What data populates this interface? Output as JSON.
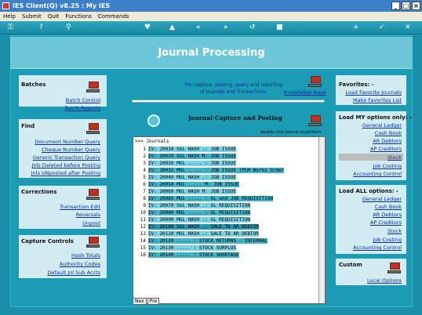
{
  "window": {
    "title": "IES Client(Q) v8.25 : My IES"
  },
  "menu": [
    "Help",
    "Submit",
    "Quit",
    "Functions",
    "Commands"
  ],
  "header": {
    "title": "Journal Processing"
  },
  "info": {
    "line1": "For capture, posting, query and reporting",
    "line2": "of Journals and Transactions.",
    "knowledge": "Knowledge Base"
  },
  "capture": {
    "title": "Journal Capture and Posting",
    "hint": "double-click journal to perform"
  },
  "left": {
    "batches": {
      "label": "Batches",
      "links": [
        "Batch Control",
        "Batch Reports"
      ]
    },
    "find": {
      "label": "Find",
      "links": [
        "Document Number Query",
        "Cheque Number Query",
        "Generic Transaction Query",
        "Jnls Deleted before Posting",
        "Jnls UNposted after Posting"
      ]
    },
    "corrections": {
      "label": "Corrections",
      "links": [
        "Transaction Edit",
        "Reversals",
        "Unpost"
      ]
    },
    "capture_controls": {
      "label": "Capture Controls",
      "links": [
        "Hash Totals",
        "Authority Codes",
        "Default Jnl Sub Accts"
      ]
    }
  },
  "right": {
    "favorites": {
      "label": "Favorites: -",
      "links": [
        "Load Favorite Journals",
        "Make Favorites List"
      ]
    },
    "my": {
      "label": "Load MY options only: -",
      "links": [
        "General Ledger",
        "Cash Book",
        "AR Debtors",
        "AP Creditors",
        "Stock",
        "Job Costing",
        "Accounting Control"
      ]
    },
    "all": {
      "label": "Load ALL options: -",
      "links": [
        "General Ledger",
        "Cash Book",
        "AR Debtors",
        "AP Creditors",
        "Stock",
        "Job Costing",
        "Accounting Control"
      ]
    },
    "custom": {
      "label": "Custom",
      "links": [
        "Local Options"
      ]
    }
  },
  "list": {
    "header": ">>> Journals",
    "rows": [
      {
        "n": "1",
        "t": "IV: 20010 SGL HASH .: JOB ISSUE"
      },
      {
        "n": "2",
        "t": "IV: 20020 SGL HASH M: JOB ISSUE"
      },
      {
        "n": "3",
        "t": "IV: 20030 MUL ..... : JOB ISSUE"
      },
      {
        "n": "4",
        "t": "IV: 20032 MUL ..... : JOB ISSUE (PLM Works Order"
      },
      {
        "n": "5",
        "t": "IV: 20040 MUL HASH .: JOB ISSUE"
      },
      {
        "n": "6",
        "t": "IV: 20050 MUL ..... M: JOB ISSUE"
      },
      {
        "n": "7",
        "t": "IV: 20060 MUL HASH M: JOB ISSUE"
      },
      {
        "n": "8",
        "t": "IV: 20065 MUL ..... : GL and JOB REQUISITION"
      },
      {
        "n": "9",
        "t": "IV: 20070 SGL HASH .: GL REQUISITION"
      },
      {
        "n": "10",
        "t": "IV: 20080 MUL ..... : GL REQUISITION"
      },
      {
        "n": "11",
        "t": "IV: 20090 MUL HASH .: GL REQUISITION"
      },
      {
        "n": "12",
        "t": "IV: 20100 SGL HASH .: SALE TO AR DEBTOR"
      },
      {
        "n": "13",
        "t": "IV: 20110 MUL HASH .: SALE TO AR DEBTOR"
      },
      {
        "n": "14",
        "t": "IV: 20120 ..... : STOCK RETURNS - INTERNAL"
      },
      {
        "n": "15",
        "t": "IV: 20130 ..... : STOCK SURPLUS"
      },
      {
        "n": "16",
        "t": "IV: 20140 ..... : STOCK SHORTAGE"
      }
    ]
  },
  "tabs": [
    "Nex",
    "Pre"
  ]
}
